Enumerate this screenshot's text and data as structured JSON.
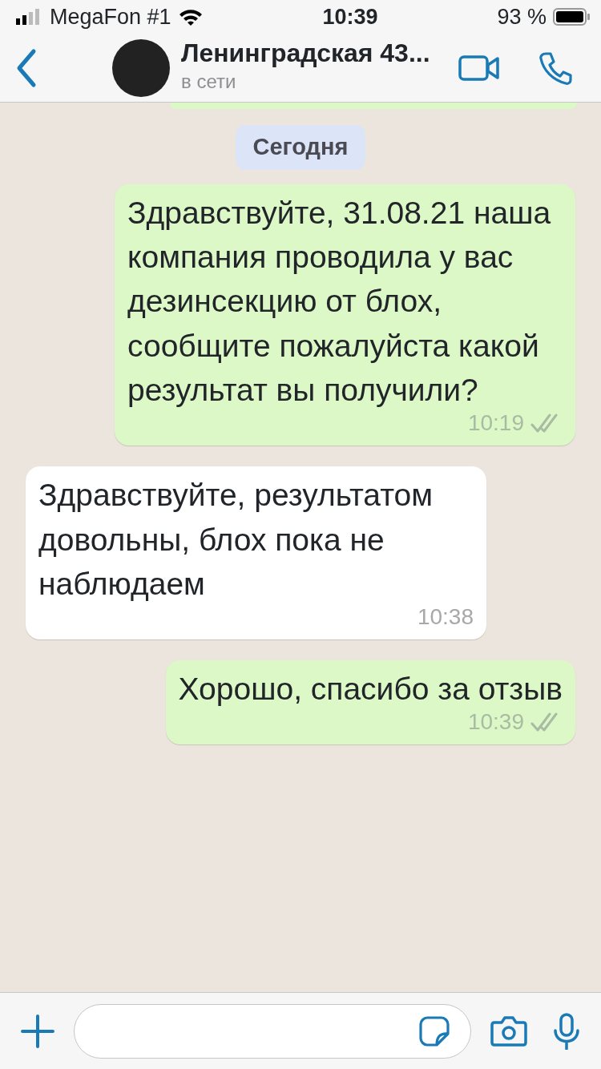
{
  "status_bar": {
    "carrier": "MegaFon #1",
    "time": "10:39",
    "battery": "93 %"
  },
  "header": {
    "title": "Ленинградская 43...",
    "subtitle": "в сети"
  },
  "date_label": "Сегодня",
  "messages": [
    {
      "kind": "outgoing",
      "text": "Здравствуйте, 31.08.21 наша компания проводила у вас дезинсекцию от блох, сообщите пожалуйста какой результат вы получили?",
      "time": "10:19",
      "read": false
    },
    {
      "kind": "incoming",
      "text": "Здравствуйте, результатом довольны, блох пока не наблюдаем",
      "time": "10:38"
    },
    {
      "kind": "outgoing",
      "text": "Хорошо, спасибо за отзыв",
      "time": "10:39",
      "read": false
    }
  ]
}
